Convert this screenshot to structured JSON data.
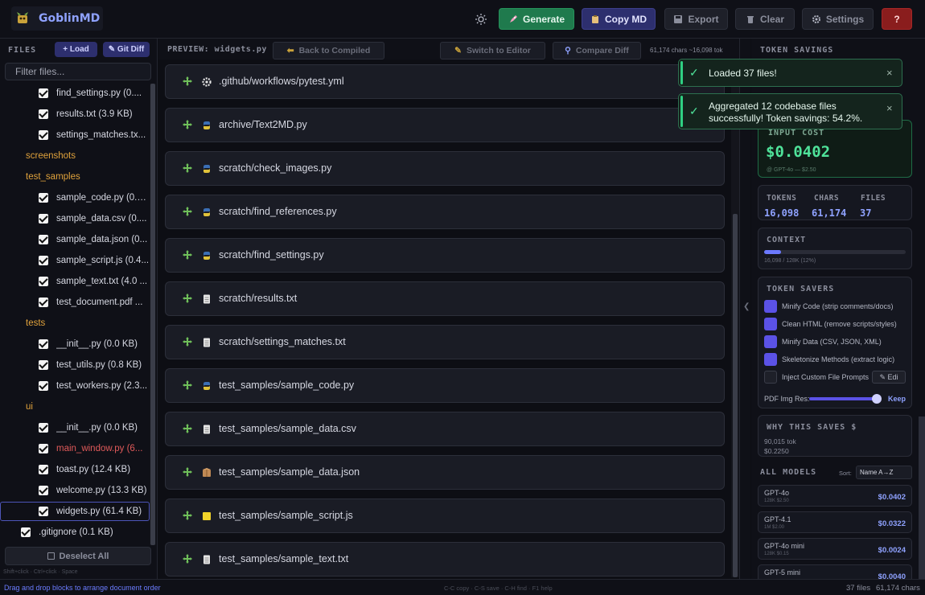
{
  "app": {
    "title": "GoblinMD"
  },
  "toolbar": {
    "generate": "Generate",
    "copy_md": "Copy MD",
    "export": "Export",
    "clear": "Clear",
    "settings": "Settings",
    "help": "?"
  },
  "sidebar": {
    "label": "FILES",
    "load": "Load",
    "git_diff": "Git Diff",
    "filter_placeholder": "Filter files...",
    "deselect_all": "Deselect All",
    "hint": "Shift+click · Ctrl+click · Space",
    "tree": [
      {
        "type": "file",
        "name": "find_settings.py (0....",
        "indent": 48
      },
      {
        "type": "file",
        "name": "results.txt (3.9 KB)",
        "indent": 48
      },
      {
        "type": "file",
        "name": "settings_matches.tx...",
        "indent": 48
      },
      {
        "type": "folder",
        "name": "screenshots",
        "indent": 32
      },
      {
        "type": "folder",
        "name": "test_samples",
        "indent": 32
      },
      {
        "type": "file",
        "name": "sample_code.py (0.6...",
        "indent": 48
      },
      {
        "type": "file",
        "name": "sample_data.csv (0....",
        "indent": 48
      },
      {
        "type": "file",
        "name": "sample_data.json (0...",
        "indent": 48
      },
      {
        "type": "file",
        "name": "sample_script.js (0.4...",
        "indent": 48
      },
      {
        "type": "file",
        "name": "sample_text.txt (4.0 ...",
        "indent": 48
      },
      {
        "type": "file",
        "name": "test_document.pdf ...",
        "indent": 48
      },
      {
        "type": "folder",
        "name": "tests",
        "indent": 32
      },
      {
        "type": "file",
        "name": "__init__.py (0.0 KB)",
        "indent": 48
      },
      {
        "type": "file",
        "name": "test_utils.py (0.8 KB)",
        "indent": 48
      },
      {
        "type": "file",
        "name": "test_workers.py (2.3...",
        "indent": 48
      },
      {
        "type": "folder",
        "name": "ui",
        "indent": 32
      },
      {
        "type": "file",
        "name": "__init__.py (0.0 KB)",
        "indent": 48
      },
      {
        "type": "file",
        "name": "main_window.py (6...",
        "indent": 48,
        "modified": true
      },
      {
        "type": "file",
        "name": "toast.py (12.4 KB)",
        "indent": 48
      },
      {
        "type": "file",
        "name": "welcome.py (13.3 KB)",
        "indent": 48
      },
      {
        "type": "file",
        "name": "widgets.py (61.4 KB)",
        "indent": 48,
        "selected": true
      },
      {
        "type": "file",
        "name": ".gitignore (0.1 KB)",
        "indent": 26
      }
    ]
  },
  "preview": {
    "title": "PREVIEW: widgets.py",
    "back": "Back to Compiled",
    "switch": "Switch to Editor",
    "compare": "Compare Diff",
    "stats": "61,174 chars  ~16,098 tok",
    "blocks": [
      {
        "path": ".github/workflows/pytest.yml",
        "icon": "gear-icon"
      },
      {
        "path": "archive/Text2MD.py",
        "icon": "python-icon"
      },
      {
        "path": "scratch/check_images.py",
        "icon": "python-icon"
      },
      {
        "path": "scratch/find_references.py",
        "icon": "python-icon"
      },
      {
        "path": "scratch/find_settings.py",
        "icon": "python-icon"
      },
      {
        "path": "scratch/results.txt",
        "icon": "text-file-icon"
      },
      {
        "path": "scratch/settings_matches.txt",
        "icon": "text-file-icon"
      },
      {
        "path": "test_samples/sample_code.py",
        "icon": "python-icon"
      },
      {
        "path": "test_samples/sample_data.csv",
        "icon": "text-file-icon"
      },
      {
        "path": "test_samples/sample_data.json",
        "icon": "package-icon"
      },
      {
        "path": "test_samples/sample_script.js",
        "icon": "js-icon"
      },
      {
        "path": "test_samples/sample_text.txt",
        "icon": "text-file-icon"
      }
    ]
  },
  "right": {
    "token_savings_label": "TOKEN SAVINGS",
    "input_cost_label": "INPUT COST",
    "input_cost_value": "$0.0402",
    "input_cost_sub": "@ GPT-4o — $2.50",
    "stats": {
      "tokens_label": "TOKENS",
      "tokens_value": "16,098",
      "chars_label": "CHARS",
      "chars_value": "61,174",
      "files_label": "FILES",
      "files_value": "37"
    },
    "context_label": "CONTEXT",
    "context_sub": "16,098 / 128K (12%)",
    "context_fraction": 0.12,
    "savers_label": "TOKEN SAVERS",
    "savers": [
      {
        "label": "Minify Code (strip comments/docs)",
        "checked": true
      },
      {
        "label": "Clean HTML (remove scripts/styles)",
        "checked": true
      },
      {
        "label": "Minify Data (CSV, JSON, XML)",
        "checked": true
      },
      {
        "label": "Skeletonize Methods (extract logic)",
        "checked": true
      },
      {
        "label": "Inject Custom File Prompts",
        "checked": false
      }
    ],
    "edit_label": "Edi",
    "pdf_label": "PDF Img Res:",
    "pdf_value": "Keep",
    "why_label": "WHY THIS SAVES $",
    "why_line1": "90,015 tok",
    "why_line2": "$0.2250",
    "models_label": "ALL MODELS",
    "sort_label": "Sort:",
    "sort_value": "Name A→Z",
    "models": [
      {
        "name": "GPT-4o",
        "sub": "128K  $2.50",
        "price": "$0.0402"
      },
      {
        "name": "GPT-4.1",
        "sub": "1M  $2.00",
        "price": "$0.0322"
      },
      {
        "name": "GPT-4o mini",
        "sub": "128K  $0.15",
        "price": "$0.0024"
      },
      {
        "name": "GPT-5 mini",
        "sub": "",
        "price": "$0.0040"
      }
    ]
  },
  "toasts": [
    {
      "text": "Loaded 37 files!"
    },
    {
      "text": "Aggregated 12 codebase files successfully! Token savings: 54.2%."
    }
  ],
  "status": {
    "left": "Drag and drop blocks to arrange document order",
    "center": "C-C copy · C-S save · C-H find · F1 help",
    "files": "37 files",
    "chars": "61,174 chars"
  },
  "colors": {
    "accent": "#8fa2ff",
    "success": "#4fe39a",
    "folder": "#e0a23c",
    "modified": "#e05a5a"
  }
}
